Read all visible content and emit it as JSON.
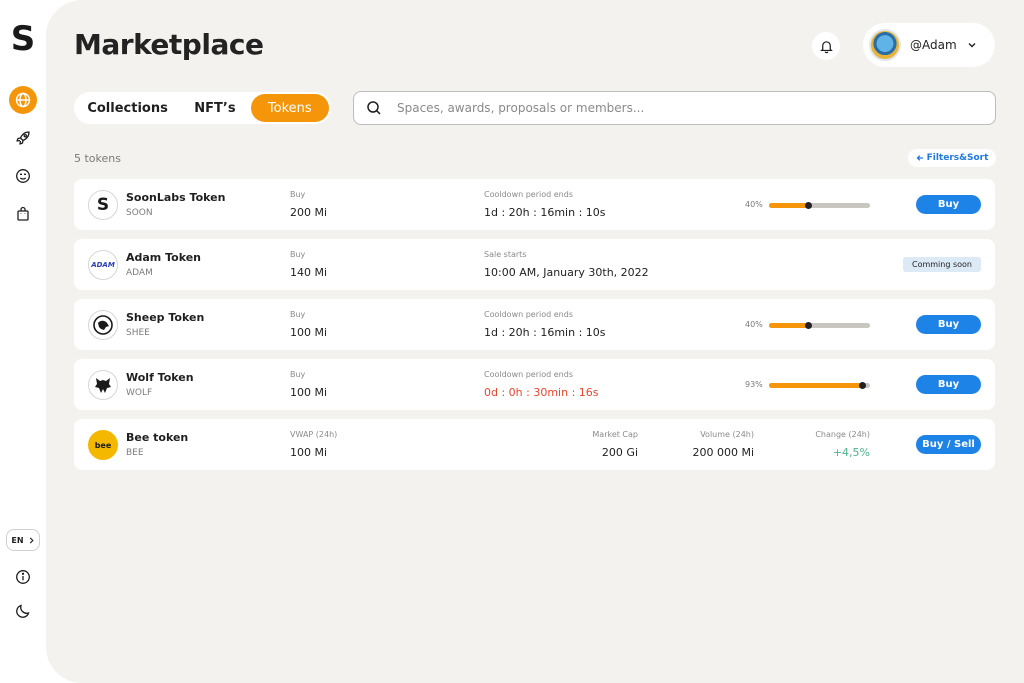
{
  "app": {
    "logo_letter": "S",
    "lang": "EN"
  },
  "header": {
    "title": "Marketplace",
    "user_name": "@Adam"
  },
  "tabs": [
    {
      "label": "Collections"
    },
    {
      "label": "NFT’s"
    },
    {
      "label": "Tokens",
      "active": true
    }
  ],
  "search": {
    "placeholder": "Spaces, awards, proposals or members..."
  },
  "list": {
    "count": "5 tokens",
    "filters_label": "Filters&Sort"
  },
  "tokens": [
    {
      "name": "SoonLabs Token",
      "symbol": "SOON",
      "price_label": "Buy",
      "price": "200 Mi",
      "status_label": "Cooldown period ends",
      "status_value": "1d : 20h : 16min : 10s",
      "progress_text": "40%",
      "progress": 0.4,
      "action": "Buy"
    },
    {
      "name": "Adam Token",
      "symbol": "ADAM",
      "logo_text": "ADAM",
      "price_label": "Buy",
      "price": "140 Mi",
      "status_label": "Sale starts",
      "status_value": "10:00 AM, January 30th, 2022",
      "badge": "Comming soon"
    },
    {
      "name": "Sheep Token",
      "symbol": "SHEE",
      "price_label": "Buy",
      "price": "100 Mi",
      "status_label": "Cooldown period ends",
      "status_value": "1d : 20h : 16min : 10s",
      "progress_text": "40%",
      "progress": 0.4,
      "action": "Buy"
    },
    {
      "name": "Wolf Token",
      "symbol": "WOLF",
      "price_label": "Buy",
      "price": "100 Mi",
      "status_label": "Cooldown period ends",
      "status_value": "0d : 0h : 30min : 16s",
      "progress_text": "93%",
      "progress": 0.93,
      "action": "Buy"
    },
    {
      "name": "Bee token",
      "symbol": "BEE",
      "logo_text": "bee",
      "price_label": "VWAP (24h)",
      "price": "100 Mi",
      "market_cap_label": "Market Cap",
      "market_cap": "200 Gi",
      "volume_label": "Volume (24h)",
      "volume": "200 000 Mi",
      "change_label": "Change (24h)",
      "change": "+4,5%",
      "action": "Buy / Sell"
    }
  ],
  "colors": {
    "accent": "#f5960a",
    "button": "#1d83e6",
    "danger": "#e8462c",
    "positive": "#4cb48a",
    "background": "#f4f2ee"
  },
  "icons": [
    "globe-icon",
    "rocket-icon",
    "smile-icon",
    "bag-icon",
    "info-icon",
    "moon-icon",
    "bell-icon",
    "search-icon",
    "chevron-down-icon",
    "arrow-left-icon"
  ]
}
